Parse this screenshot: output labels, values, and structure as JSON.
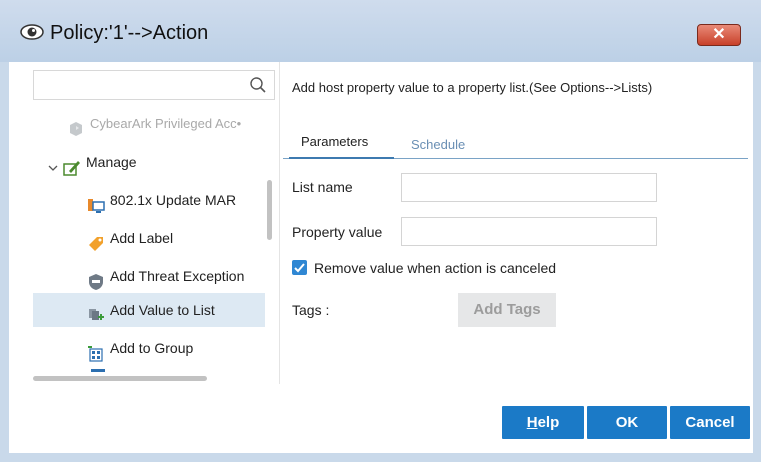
{
  "window": {
    "title": "Policy:'1'-->Action",
    "close_glyph": "✕"
  },
  "search": {
    "value": "",
    "placeholder": ""
  },
  "tree": {
    "items": [
      {
        "label": "CybearArk Privileged Acc•",
        "icon": "cyberark-icon",
        "state": "disabled"
      },
      {
        "label": "Manage",
        "icon": "manage-icon",
        "state": "expanded-group"
      },
      {
        "label": "802.1x Update MAR",
        "icon": "mar-icon",
        "state": "normal"
      },
      {
        "label": "Add Label",
        "icon": "label-tag-icon",
        "state": "normal"
      },
      {
        "label": "Add Threat Exception",
        "icon": "threat-exception-icon",
        "state": "normal"
      },
      {
        "label": "Add Value to List",
        "icon": "add-value-list-icon",
        "state": "selected"
      },
      {
        "label": "Add to Group",
        "icon": "group-icon",
        "state": "normal"
      }
    ]
  },
  "description": "Add host property value to a property list.(See Options-->Lists)",
  "tabs": [
    {
      "label": "Parameters",
      "active": true
    },
    {
      "label": "Schedule",
      "active": false
    }
  ],
  "form": {
    "list_name_label": "List name",
    "list_name_value": "",
    "property_value_label": "Property value",
    "property_value_value": "",
    "remove_value_label": "Remove value when action is canceled",
    "remove_value_checked": true,
    "tags_label": "Tags :",
    "add_tags_label": "Add Tags"
  },
  "buttons": {
    "help_first": "H",
    "help_rest": "elp",
    "ok": "OK",
    "cancel": "Cancel"
  },
  "colors": {
    "accent": "#1b7ac7",
    "selected_row": "#dde9f3",
    "close_red": "#c8412a"
  }
}
